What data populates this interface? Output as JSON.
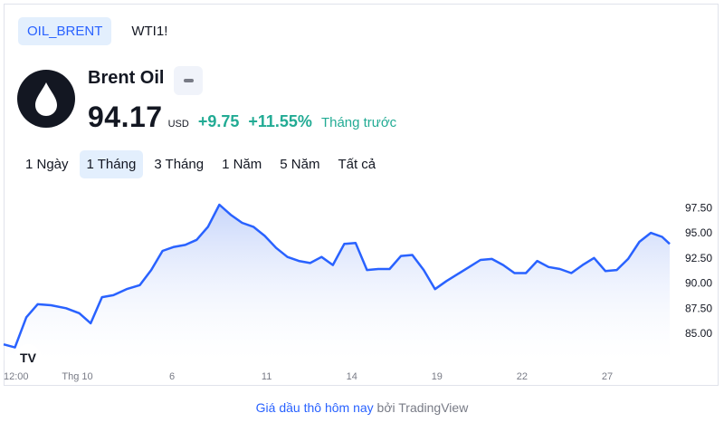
{
  "symbol_tabs": [
    {
      "label": "OIL_BRENT",
      "active": true
    },
    {
      "label": "WTI1!",
      "active": false
    }
  ],
  "instrument": {
    "name": "Brent Oil",
    "logo_icon": "oil-drop-icon",
    "price": "94.17",
    "currency": "USD",
    "change": "+9.75",
    "change_pct": "+11.55%",
    "period_label": "Tháng trước"
  },
  "range_tabs": [
    {
      "label": "1 Ngày",
      "active": false
    },
    {
      "label": "1 Tháng",
      "active": true
    },
    {
      "label": "3 Tháng",
      "active": false
    },
    {
      "label": "1 Năm",
      "active": false
    },
    {
      "label": "5 Năm",
      "active": false
    },
    {
      "label": "Tất cả",
      "active": false
    }
  ],
  "colors": {
    "line": "#2962ff",
    "area_top": "#c8d6fa",
    "area_bottom": "#ffffff",
    "up": "#22ab94",
    "text": "#131722",
    "axis_text": "#787b86"
  },
  "chart_data": {
    "type": "area",
    "xlabel": "",
    "ylabel": "",
    "x_ticks": [
      "12:00",
      "Thg 10",
      "6",
      "11",
      "14",
      "19",
      "22",
      "27"
    ],
    "y_ticks": [
      "97.50",
      "95.00",
      "92.50",
      "90.00",
      "87.50",
      "85.00"
    ],
    "ylim": [
      82.3,
      98.7
    ],
    "x_tick_positions": [
      0,
      3.9,
      8.9,
      13.9,
      18.4,
      22.9,
      27.4,
      31.9
    ],
    "xlim": [
      0,
      35.2
    ],
    "x": [
      0,
      0.6,
      1.2,
      1.8,
      2.5,
      3.3,
      4.0,
      4.6,
      5.2,
      5.8,
      6.5,
      7.2,
      7.8,
      8.4,
      9.0,
      9.6,
      10.2,
      10.8,
      11.4,
      12.0,
      12.6,
      13.2,
      13.8,
      14.4,
      15.0,
      15.6,
      16.2,
      16.8,
      17.4,
      18.0,
      18.6,
      19.2,
      19.8,
      20.4,
      21.0,
      21.6,
      22.2,
      22.8,
      23.4,
      24.0,
      24.6,
      25.2,
      25.8,
      26.4,
      27.0,
      27.6,
      28.2,
      28.8,
      29.4,
      30.0,
      30.6,
      31.2,
      31.8,
      32.4,
      33.0,
      33.6,
      34.2,
      34.8,
      35.2
    ],
    "y": [
      83.9,
      83.6,
      86.6,
      87.9,
      87.8,
      87.5,
      87.0,
      86.0,
      88.6,
      88.8,
      89.4,
      89.8,
      91.3,
      93.2,
      93.6,
      93.8,
      94.3,
      95.6,
      97.8,
      96.8,
      96.0,
      95.6,
      94.7,
      93.5,
      92.6,
      92.2,
      92.0,
      92.6,
      91.8,
      93.9,
      94.0,
      91.3,
      91.4,
      91.4,
      92.7,
      92.8,
      91.3,
      89.4,
      90.2,
      90.9,
      91.6,
      92.3,
      92.4,
      91.8,
      91.0,
      91.0,
      92.2,
      91.6,
      91.4,
      91.0,
      91.8,
      92.5,
      91.2,
      91.3,
      92.4,
      94.1,
      95.0,
      94.6,
      93.9
    ]
  },
  "branding": {
    "logo_text": "TV",
    "logo_icon": "tradingview-logo-icon"
  },
  "caption": {
    "link_text": "Giá dầu thô hôm nay",
    "by_text": "bởi TradingView"
  }
}
